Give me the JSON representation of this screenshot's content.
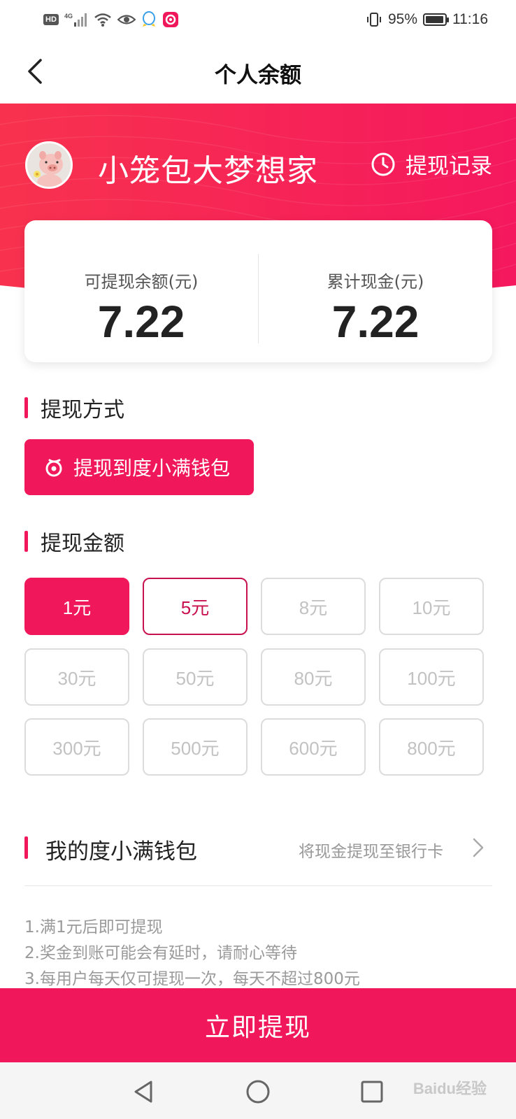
{
  "status_bar": {
    "network": "4G",
    "battery": "95%",
    "battery_fraction": 0.95,
    "time": "11:16"
  },
  "nav": {
    "title": "个人余额"
  },
  "header": {
    "username": "小笼包大梦想家",
    "records_label": "提现记录"
  },
  "balance": {
    "withdrawable_label": "可提现余额(元)",
    "withdrawable_value": "7.22",
    "cumulative_label": "累计现金(元)",
    "cumulative_value": "7.22"
  },
  "method_section": {
    "title": "提现方式",
    "option_label": "提现到度小满钱包"
  },
  "amount_section": {
    "title": "提现金额",
    "options": [
      "1元",
      "5元",
      "8元",
      "10元",
      "30元",
      "50元",
      "80元",
      "100元",
      "300元",
      "500元",
      "600元",
      "800元"
    ],
    "selected": "1元"
  },
  "wallet": {
    "title": "我的度小满钱包",
    "subtitle": "将现金提现至银行卡"
  },
  "notes": [
    "1.满1元后即可提现",
    "2.奖金到账可能会有延时，请耐心等待",
    "3.每用户每天仅可提现一次，每天不超过800元"
  ],
  "withdraw_button": "立即提现",
  "watermark": "Baidu经验",
  "colors": {
    "accent": "#f0185a",
    "active_border": "#c8124e",
    "disabled_text": "#c2c2c2"
  }
}
